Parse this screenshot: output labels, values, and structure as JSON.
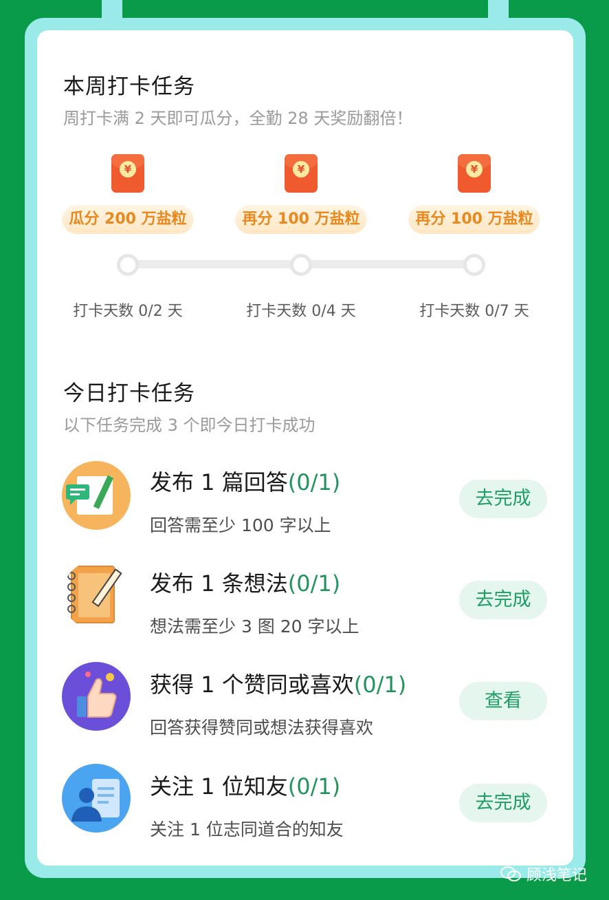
{
  "weekly": {
    "title": "本周打卡任务",
    "subtitle": "周打卡满 2 天即可瓜分，全勤 28 天奖励翻倍！",
    "milestones": [
      {
        "reward": "瓜分 200 万盐粒",
        "days": "打卡天数 0/2 天"
      },
      {
        "reward": "再分 100 万盐粒",
        "days": "打卡天数 0/4 天"
      },
      {
        "reward": "再分 100 万盐粒",
        "days": "打卡天数 0/7 天"
      }
    ],
    "coin_symbol": "¥"
  },
  "daily": {
    "title": "今日打卡任务",
    "subtitle": "以下任务完成 3 个即今日打卡成功",
    "tasks": [
      {
        "title": "发布 1 篇回答",
        "progress": "(0/1)",
        "desc": "回答需至少 100 字以上",
        "button": "去完成",
        "icon": "answer-edit-icon"
      },
      {
        "title": "发布 1 条想法",
        "progress": "(0/1)",
        "desc": "想法需至少 3 图 20 字以上",
        "button": "去完成",
        "icon": "notebook-pencil-icon"
      },
      {
        "title": "获得 1 个赞同或喜欢",
        "progress": "(0/1)",
        "desc": "回答获得赞同或想法获得喜欢",
        "button": "查看",
        "icon": "thumbs-up-icon"
      },
      {
        "title": "关注 1 位知友",
        "progress": "(0/1)",
        "desc": "关注 1 位志同道合的知友",
        "button": "去完成",
        "icon": "profile-card-icon"
      }
    ]
  },
  "watermark": "顾浅笔记",
  "colors": {
    "background": "#0a9b4a",
    "frame": "#9aeaea",
    "accent_green": "#23935e",
    "reward_orange": "#e8891f",
    "packet_red": "#ef5a2f"
  }
}
